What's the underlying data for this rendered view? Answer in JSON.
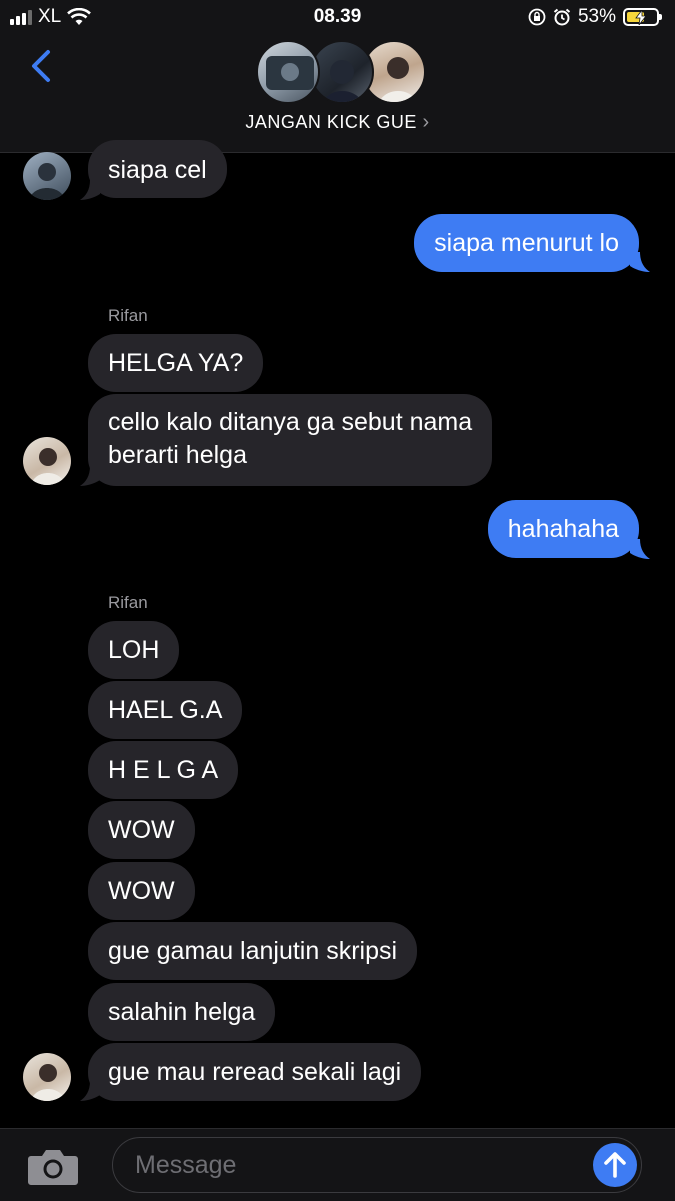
{
  "status_bar": {
    "carrier": "XL",
    "time": "08.39",
    "battery": "53%"
  },
  "header": {
    "group_name": "JANGAN KICK GUE",
    "chevron": "›"
  },
  "messages": [
    {
      "dir": "in",
      "text": "siapa cel"
    },
    {
      "dir": "out",
      "text": "siapa menurut lo"
    },
    {
      "dir": "in",
      "sender": "Rifan",
      "text": "HELGA YA?"
    },
    {
      "dir": "in",
      "line1": "cello kalo ditanya ga sebut nama",
      "line2": "berarti helga"
    },
    {
      "dir": "out",
      "text": "hahahaha"
    },
    {
      "dir": "in",
      "sender": "Rifan",
      "text": "LOH"
    },
    {
      "dir": "in",
      "text": "HAEL G.A"
    },
    {
      "dir": "in",
      "text": "H E L G A"
    },
    {
      "dir": "in",
      "text": "WOW"
    },
    {
      "dir": "in",
      "text": "WOW"
    },
    {
      "dir": "in",
      "text": "gue gamau lanjutin skripsi"
    },
    {
      "dir": "in",
      "text": "salahin helga"
    },
    {
      "dir": "in",
      "text": "gue mau reread sekali lagi"
    }
  ],
  "composer": {
    "placeholder": "Message"
  },
  "colors": {
    "incoming": "#26252a",
    "outgoing": "#3e7cf3",
    "accent": "#3e7cf3"
  },
  "icons": [
    "signal-icon",
    "wifi-icon",
    "orientation-lock-icon",
    "alarm-icon",
    "battery-icon",
    "back-chevron-icon",
    "camera-icon",
    "send-arrow-icon"
  ]
}
